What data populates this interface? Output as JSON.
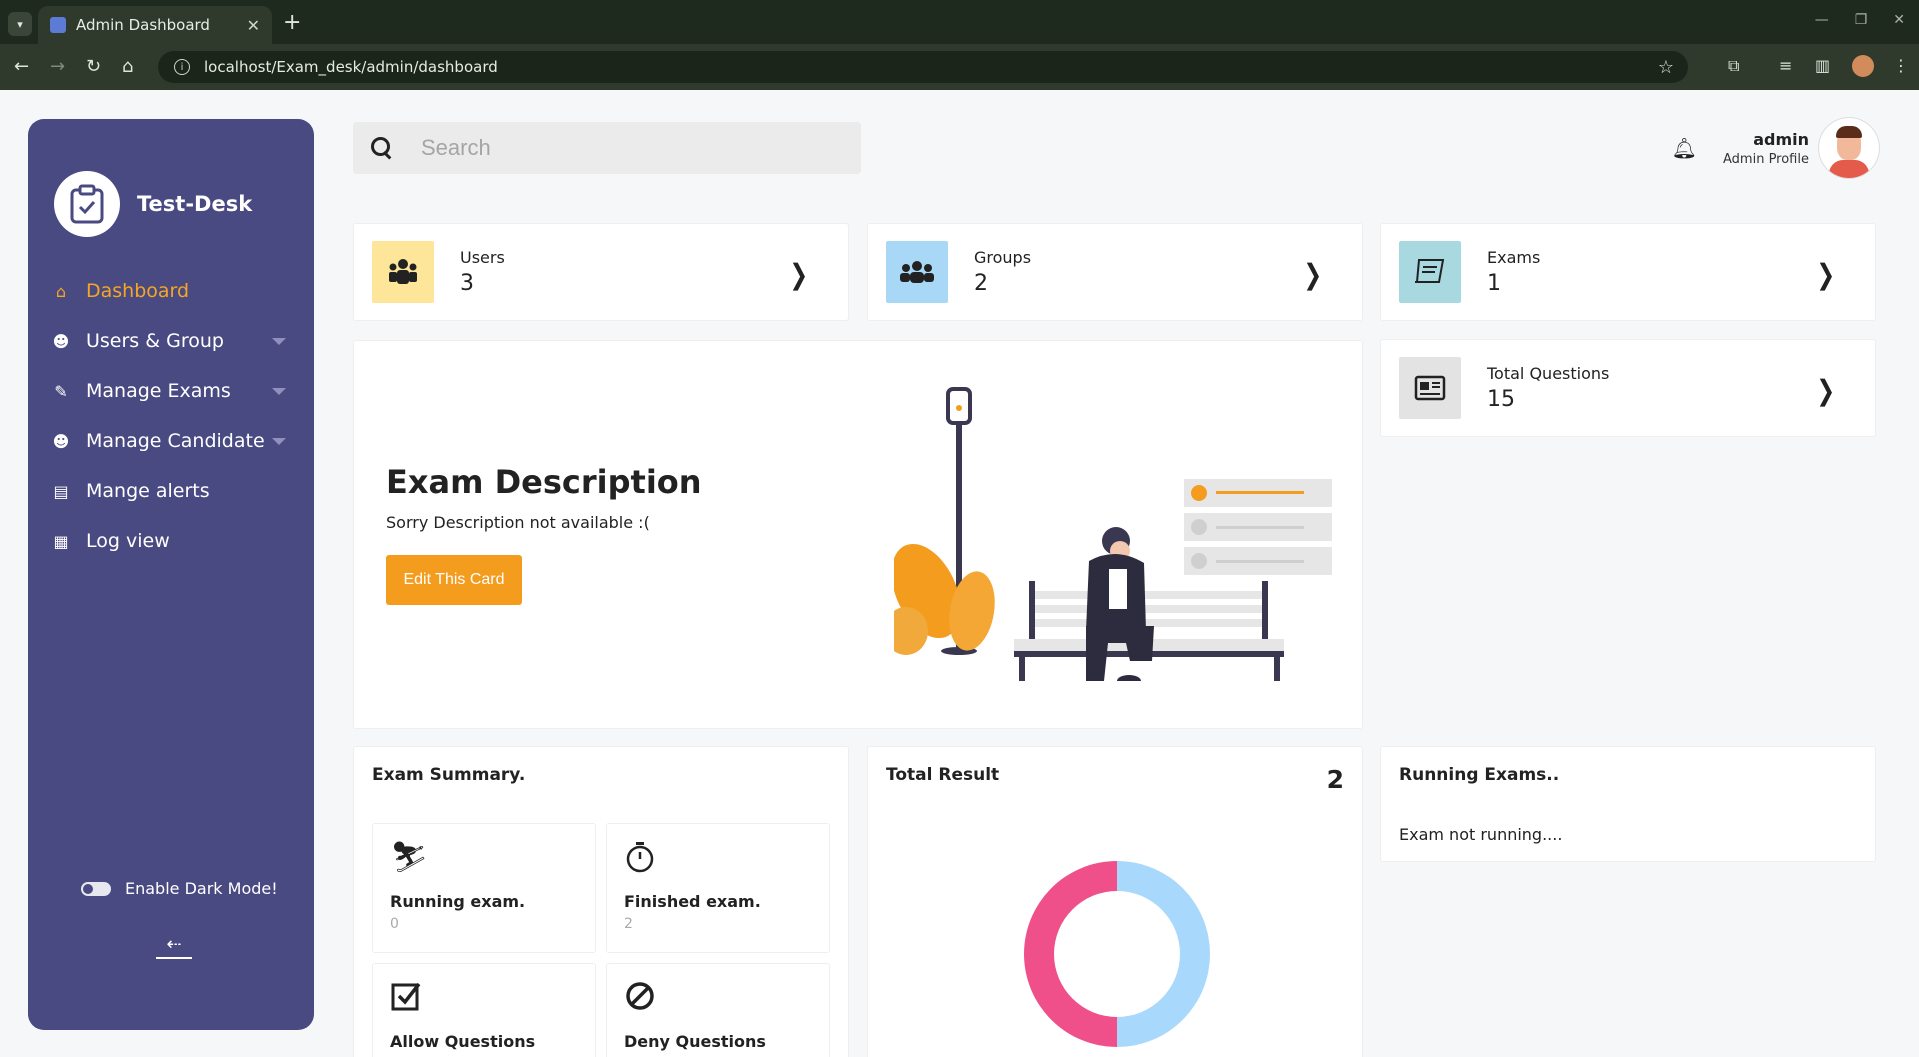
{
  "browser": {
    "tab_title": "Admin Dashboard",
    "url": "localhost/Exam_desk/admin/dashboard"
  },
  "sidebar": {
    "brand": "Test-Desk",
    "items": [
      {
        "label": "Dashboard",
        "icon": "home-icon",
        "active": true
      },
      {
        "label": "Users & Group",
        "icon": "users-icon",
        "dropdown": true
      },
      {
        "label": "Manage Exams",
        "icon": "scroll-icon",
        "dropdown": true
      },
      {
        "label": "Manage Candidate",
        "icon": "candidates-icon",
        "dropdown": true
      },
      {
        "label": "Mange alerts",
        "icon": "alerts-icon"
      },
      {
        "label": "Log view",
        "icon": "clipboard-icon"
      }
    ],
    "dark_mode_label": "Enable Dark Mode!"
  },
  "search": {
    "placeholder": "Search"
  },
  "user": {
    "name": "admin",
    "role": "Admin Profile"
  },
  "stats": [
    {
      "label": "Users",
      "value": "3",
      "icon": "users-icon",
      "color": "#fde59a"
    },
    {
      "label": "Groups",
      "value": "2",
      "icon": "group-icon",
      "color": "#a8d8f5"
    },
    {
      "label": "Exams",
      "value": "1",
      "icon": "scroll-icon",
      "color": "#a8d8e0"
    },
    {
      "label": "Total Questions",
      "value": "15",
      "icon": "newspaper-icon",
      "color": "#e3e3e3"
    }
  ],
  "description": {
    "title": "Exam Description",
    "text": "Sorry Description not available :(",
    "button": "Edit This Card"
  },
  "exam_summary": {
    "title": "Exam Summary.",
    "items": [
      {
        "label": "Running exam.",
        "value": "0",
        "icon": "skier-icon"
      },
      {
        "label": "Finished exam.",
        "value": "2",
        "icon": "stopwatch-icon"
      },
      {
        "label": "Allow Questions",
        "value": "",
        "icon": "checkbox-icon"
      },
      {
        "label": "Deny Questions",
        "value": "",
        "icon": "ban-icon"
      }
    ]
  },
  "total_result": {
    "title": "Total Result",
    "count": "2",
    "colors": {
      "pass": "#a8d8fb",
      "fail": "#f0508a"
    }
  },
  "running_exams": {
    "title": "Running Exams..",
    "text": "Exam not running...."
  },
  "colors": {
    "sidebar": "#4a4a82",
    "accent": "#f39c1e"
  }
}
